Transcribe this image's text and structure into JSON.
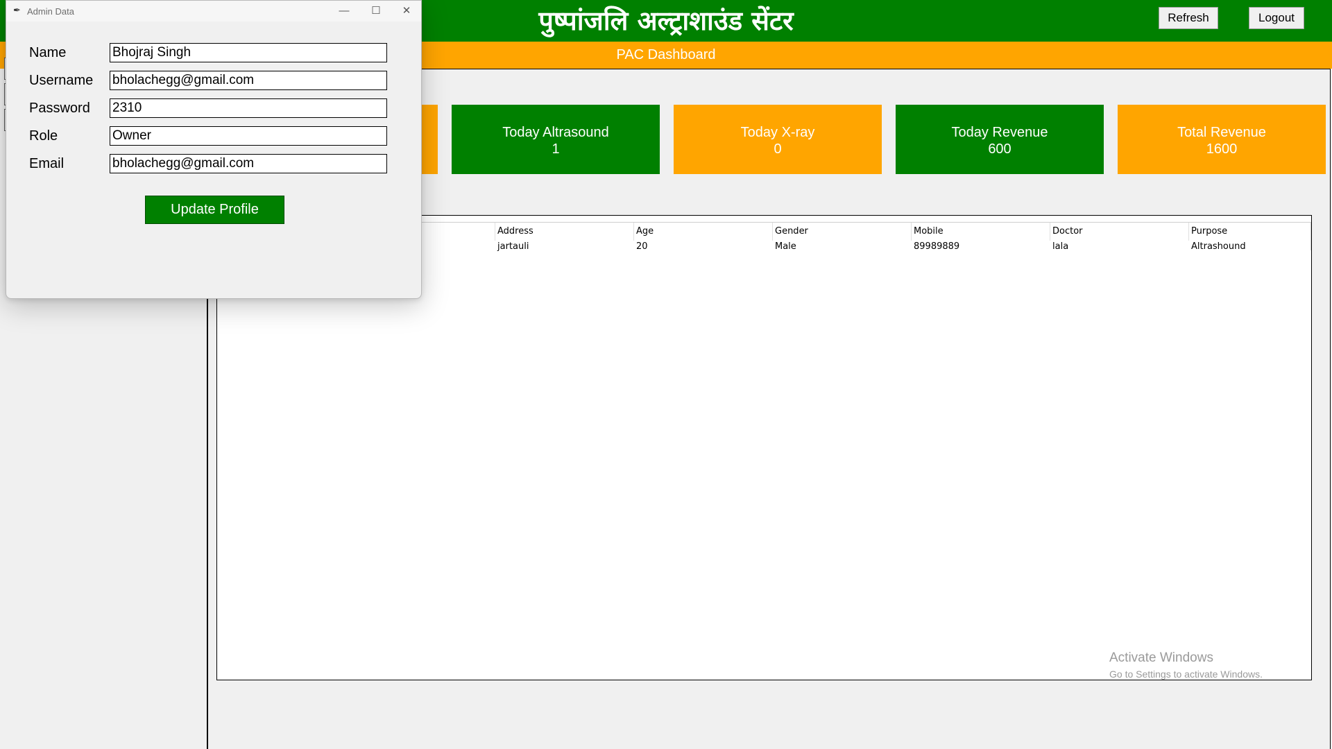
{
  "header": {
    "title": "पुष्पांजलि अल्ट्राशाउंड सेंटर",
    "refresh_label": "Refresh",
    "logout_label": "Logout"
  },
  "subheader": {
    "title": "PAC Dashboard"
  },
  "cards": [
    {
      "title": "Today Altrasound",
      "value": "1",
      "color": "#008000"
    },
    {
      "title": "Today X-ray",
      "value": "0",
      "color": "#ffa500"
    },
    {
      "title": "Today Revenue",
      "value": "600",
      "color": "#008000"
    },
    {
      "title": "Total Revenue",
      "value": "1600",
      "color": "#ffa500"
    }
  ],
  "table": {
    "columns": [
      "Address",
      "Age",
      "Gender",
      "Mobile",
      "Doctor",
      "Purpose"
    ],
    "rows": [
      [
        "jartauli",
        "20",
        "Male",
        "89989889",
        "lala",
        "Altrashound"
      ]
    ]
  },
  "watermark": {
    "line1": "Activate Windows",
    "line2": "Go to Settings to activate Windows."
  },
  "dialog": {
    "title": "Admin Data",
    "fields": [
      {
        "label": "Name",
        "value": "Bhojraj Singh"
      },
      {
        "label": "Username",
        "value": "bholachegg@gmail.com"
      },
      {
        "label": "Password",
        "value": "2310"
      },
      {
        "label": "Role",
        "value": "Owner"
      },
      {
        "label": "Email",
        "value": "bholachegg@gmail.com"
      }
    ],
    "update_label": "Update Profile"
  },
  "colors": {
    "green": "#008000",
    "orange": "#ffa500",
    "background": "#f0f0f0"
  }
}
